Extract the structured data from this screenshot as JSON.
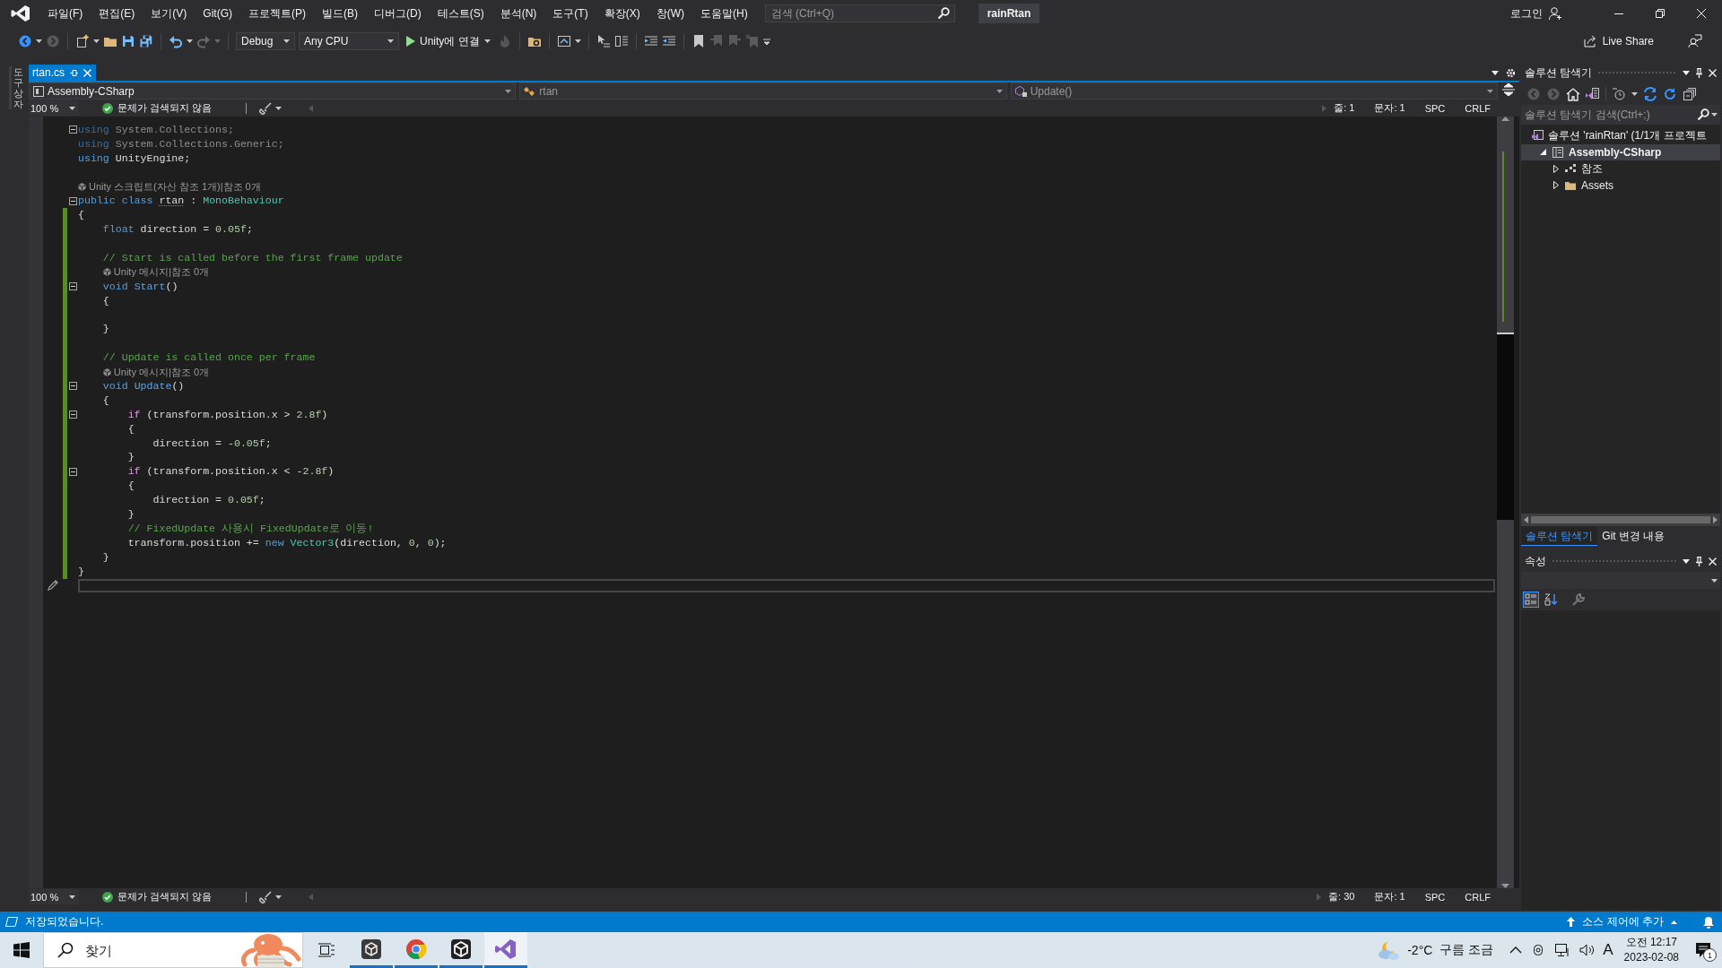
{
  "title_bar": {
    "menu": [
      "파일(F)",
      "편집(E)",
      "보기(V)",
      "Git(G)",
      "프로젝트(P)",
      "빌드(B)",
      "디버그(D)",
      "테스트(S)",
      "분석(N)",
      "도구(T)",
      "확장(X)",
      "창(W)",
      "도움말(H)"
    ],
    "search": {
      "placeholder": "검색 (Ctrl+Q)"
    },
    "solution_name": "rainRtan",
    "sign_in": "로그인"
  },
  "toolbar": {
    "configuration": "Debug",
    "platform": "Any CPU",
    "start": "Unity에 연결",
    "live_share": "Live Share"
  },
  "toolbox": {
    "label": "도구 상자"
  },
  "editor": {
    "tabs": [
      {
        "label": "rtan.cs",
        "selected": true
      }
    ],
    "nav": {
      "project": "Assembly-CSharp",
      "type": "rtan",
      "member": "Update()"
    },
    "status_top": {
      "zoom": "100 %",
      "issues": "문제가 검색되지 않음",
      "line": "줄: 1",
      "column": "문자: 1",
      "whitespace": "SPC",
      "line_ending": "CRLF"
    },
    "lines": [
      {
        "kind": "code",
        "fold": true,
        "changed": false,
        "current": false,
        "tokens": [
          {
            "kind": "kwdim",
            "text": "using"
          },
          {
            "kind": "faded",
            "text": " System.Collections;"
          }
        ]
      },
      {
        "kind": "code",
        "fold": false,
        "changed": false,
        "current": false,
        "tokens": [
          {
            "kind": "kwdim",
            "text": "using"
          },
          {
            "kind": "faded",
            "text": " System.Collections.Generic;"
          }
        ]
      },
      {
        "kind": "code",
        "fold": false,
        "changed": false,
        "current": false,
        "tokens": [
          {
            "kind": "kw",
            "text": "using"
          },
          {
            "kind": "plain",
            "text": " UnityEngine;"
          }
        ]
      },
      {
        "kind": "blank",
        "fold": false,
        "changed": false,
        "current": false
      },
      {
        "kind": "lens",
        "fold": false,
        "changed": false,
        "current": false,
        "text": "Unity 스크립트(자산 참조 1개)|참조 0개"
      },
      {
        "kind": "code",
        "fold": true,
        "changed": false,
        "current": false,
        "tokens": [
          {
            "kind": "kw",
            "text": "public class "
          },
          {
            "kind": "ident",
            "text": "rtan"
          },
          {
            "kind": "plain",
            "text": " : "
          },
          {
            "kind": "type",
            "text": "MonoBehaviour"
          }
        ]
      },
      {
        "kind": "code",
        "fold": false,
        "changed": true,
        "current": false,
        "tokens": [
          {
            "kind": "plain",
            "text": "{"
          }
        ]
      },
      {
        "kind": "code",
        "fold": false,
        "changed": true,
        "current": false,
        "tokens": [
          {
            "kind": "kw",
            "text": "    float"
          },
          {
            "kind": "plain",
            "text": " direction = "
          },
          {
            "kind": "num",
            "text": "0.05f"
          },
          {
            "kind": "plain",
            "text": ";"
          }
        ]
      },
      {
        "kind": "blank",
        "fold": false,
        "changed": true,
        "current": false
      },
      {
        "kind": "code",
        "fold": false,
        "changed": true,
        "current": false,
        "tokens": [
          {
            "kind": "comment",
            "text": "    // Start is called before the first frame update"
          }
        ]
      },
      {
        "kind": "lens",
        "fold": false,
        "changed": true,
        "current": false,
        "text": "Unity 메시지|참조 0개"
      },
      {
        "kind": "code",
        "fold": true,
        "changed": true,
        "current": false,
        "tokens": [
          {
            "kind": "kw",
            "text": "    void "
          },
          {
            "kind": "method",
            "text": "Start"
          },
          {
            "kind": "plain",
            "text": "()"
          }
        ]
      },
      {
        "kind": "code",
        "fold": false,
        "changed": true,
        "current": false,
        "tokens": [
          {
            "kind": "plain",
            "text": "    {"
          }
        ]
      },
      {
        "kind": "blank",
        "fold": false,
        "changed": true,
        "current": false
      },
      {
        "kind": "code",
        "fold": false,
        "changed": true,
        "current": false,
        "tokens": [
          {
            "kind": "plain",
            "text": "    }"
          }
        ]
      },
      {
        "kind": "blank",
        "fold": false,
        "changed": true,
        "current": false
      },
      {
        "kind": "code",
        "fold": false,
        "changed": true,
        "current": false,
        "tokens": [
          {
            "kind": "comment",
            "text": "    // Update is called once per frame"
          }
        ]
      },
      {
        "kind": "lens",
        "fold": false,
        "changed": true,
        "current": false,
        "text": "Unity 메시지|참조 0개"
      },
      {
        "kind": "code",
        "fold": true,
        "changed": true,
        "current": false,
        "tokens": [
          {
            "kind": "kw",
            "text": "    void "
          },
          {
            "kind": "method",
            "text": "Update"
          },
          {
            "kind": "plain",
            "text": "()"
          }
        ]
      },
      {
        "kind": "code",
        "fold": false,
        "changed": true,
        "current": false,
        "tokens": [
          {
            "kind": "plain",
            "text": "    {"
          }
        ]
      },
      {
        "kind": "code",
        "fold": true,
        "changed": true,
        "current": false,
        "tokens": [
          {
            "kind": "ctrl",
            "text": "        if"
          },
          {
            "kind": "plain",
            "text": " (transform.position.x > "
          },
          {
            "kind": "num",
            "text": "2.8f"
          },
          {
            "kind": "plain",
            "text": ")"
          }
        ]
      },
      {
        "kind": "code",
        "fold": false,
        "changed": true,
        "current": false,
        "tokens": [
          {
            "kind": "plain",
            "text": "        {"
          }
        ]
      },
      {
        "kind": "code",
        "fold": false,
        "changed": true,
        "current": false,
        "tokens": [
          {
            "kind": "plain",
            "text": "            direction = -"
          },
          {
            "kind": "num",
            "text": "0.05f"
          },
          {
            "kind": "plain",
            "text": ";"
          }
        ]
      },
      {
        "kind": "code",
        "fold": false,
        "changed": true,
        "current": false,
        "tokens": [
          {
            "kind": "plain",
            "text": "        }"
          }
        ]
      },
      {
        "kind": "code",
        "fold": true,
        "changed": true,
        "current": false,
        "tokens": [
          {
            "kind": "ctrl",
            "text": "        if"
          },
          {
            "kind": "plain",
            "text": " (transform.position.x < -"
          },
          {
            "kind": "num",
            "text": "2.8f"
          },
          {
            "kind": "plain",
            "text": ")"
          }
        ]
      },
      {
        "kind": "code",
        "fold": false,
        "changed": true,
        "current": false,
        "tokens": [
          {
            "kind": "plain",
            "text": "        {"
          }
        ]
      },
      {
        "kind": "code",
        "fold": false,
        "changed": true,
        "current": false,
        "tokens": [
          {
            "kind": "plain",
            "text": "            direction = "
          },
          {
            "kind": "num",
            "text": "0.05f"
          },
          {
            "kind": "plain",
            "text": ";"
          }
        ]
      },
      {
        "kind": "code",
        "fold": false,
        "changed": true,
        "current": false,
        "tokens": [
          {
            "kind": "plain",
            "text": "        }"
          }
        ]
      },
      {
        "kind": "code",
        "fold": false,
        "changed": true,
        "current": false,
        "tokens": [
          {
            "kind": "comment",
            "text": "        // FixedUpdate 사용시 FixedUpdate로 이동!"
          }
        ]
      },
      {
        "kind": "code",
        "fold": false,
        "changed": true,
        "current": false,
        "tokens": [
          {
            "kind": "plain",
            "text": "        transform.position += "
          },
          {
            "kind": "kw",
            "text": "new "
          },
          {
            "kind": "type",
            "text": "Vector3"
          },
          {
            "kind": "plain",
            "text": "(direction, "
          },
          {
            "kind": "num",
            "text": "0"
          },
          {
            "kind": "plain",
            "text": ", "
          },
          {
            "kind": "num",
            "text": "0"
          },
          {
            "kind": "plain",
            "text": ");"
          }
        ]
      },
      {
        "kind": "code",
        "fold": false,
        "changed": true,
        "current": false,
        "tokens": [
          {
            "kind": "plain",
            "text": "    }"
          }
        ]
      },
      {
        "kind": "code",
        "fold": false,
        "changed": true,
        "current": false,
        "tokens": [
          {
            "kind": "plain",
            "text": "}"
          }
        ]
      },
      {
        "kind": "blank",
        "fold": false,
        "changed": false,
        "current": true
      }
    ],
    "status_bottom": {
      "zoom": "100 %",
      "issues": "문제가 검색되지 않음",
      "line": "줄: 30",
      "column": "문자: 1",
      "whitespace": "SPC",
      "line_ending": "CRLF"
    }
  },
  "solution_explorer": {
    "title": "솔루션 탐색기",
    "search": {
      "placeholder": "솔루션 탐색기 검색(Ctrl+;)"
    },
    "tree": [
      {
        "label": "솔루션 'rainRtan' (1/1개 프로젝트",
        "kind": "solution",
        "selected": false,
        "children": [
          {
            "label": "Assembly-CSharp",
            "kind": "project",
            "expanded": true,
            "selected": true,
            "children": [
              {
                "label": "참조",
                "kind": "references",
                "expanded": false,
                "selected": false
              },
              {
                "label": "Assets",
                "kind": "folder",
                "expanded": false,
                "selected": false
              }
            ]
          }
        ]
      }
    ],
    "tabs": [
      {
        "label": "솔루션 탐색기",
        "selected": true
      },
      {
        "label": "Git 변경 내용",
        "selected": false
      }
    ]
  },
  "properties": {
    "title": "속성"
  },
  "status_bar": {
    "message": "저장되었습니다.",
    "source_control": "소스 제어에 추가"
  },
  "taskbar": {
    "search": {
      "placeholder": "찾기"
    },
    "apps": [
      {
        "kind": "unity-hub",
        "running": true,
        "selected": false
      },
      {
        "kind": "browser",
        "running": true,
        "selected": false
      },
      {
        "kind": "unity",
        "running": true,
        "selected": false
      },
      {
        "kind": "visual-studio",
        "running": true,
        "selected": true
      }
    ],
    "weather": {
      "temperature": "-2°C",
      "condition": "구름 조금"
    },
    "input_method": "A",
    "time": "오전 12:17",
    "date": "2023-02-08",
    "notifications": "1"
  }
}
